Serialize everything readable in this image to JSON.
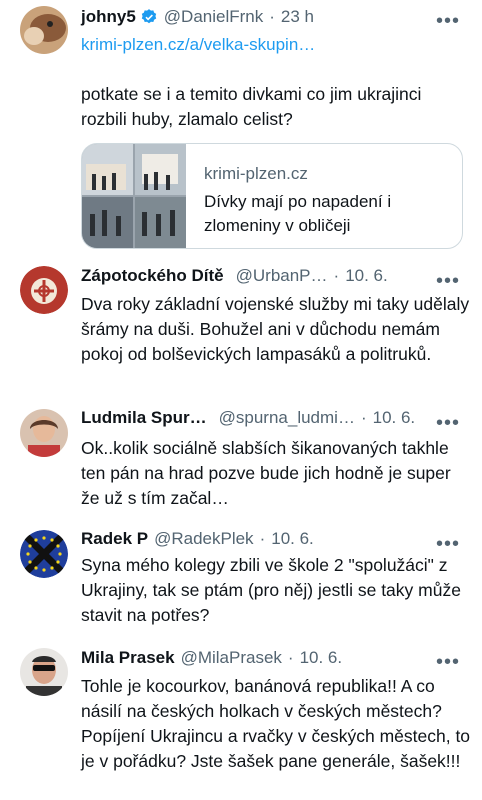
{
  "tweets": [
    {
      "name": "johny5",
      "verified": true,
      "handle": "@DanielFrnk",
      "time": "23 h",
      "link": "krimi-plzen.cz/a/velka-skupin…",
      "text": "potkate se i a temito divkami co jim ukrajinci rozbili huby, zlamalo celist?",
      "card": {
        "domain": "krimi-plzen.cz",
        "title": "Dívky mají po napadení i zlomeniny v obličeji"
      }
    },
    {
      "name": "Zápotockého Dítě",
      "handle": "@UrbanP…",
      "time": "10. 6.",
      "text": "Dva roky základní vojenské služby mi taky udělaly šrámy na duši.  Bohužel ani v důchodu nemám pokoj od bolševických lampasáků a politruků."
    },
    {
      "name": "Ludmila Spur…",
      "handle": "@spurna_ludmi…",
      "time": "10. 6.",
      "text": "Ok..kolik sociálně slabších šikanovaných takhle ten pán na hrad pozve bude jich hodně je super že už s tím začal…"
    },
    {
      "name": "Radek P",
      "handle": "@RadekPlek",
      "time": "10. 6.",
      "text": "Syna mého kolegy zbili ve škole 2 \"spolužáci\" z Ukrajiny, tak se ptám (pro něj) jestli se taky může stavit na potřes?"
    },
    {
      "name": "Mila Prasek",
      "handle": "@MilaPrasek",
      "time": "10. 6.",
      "text": "Tohle je kocourkov, banánová republika!! A co násilí na českých holkach v českých městech? Popíjení Ukrajincu a rvačky v českých městech, to je v pořádku? Jste šašek pane generále, šašek!!!"
    }
  ],
  "separator": "·",
  "more_glyph": "•••",
  "colors": {
    "accent": "#1d9bf0",
    "secondary_text": "#536471",
    "text": "#0f1419"
  }
}
